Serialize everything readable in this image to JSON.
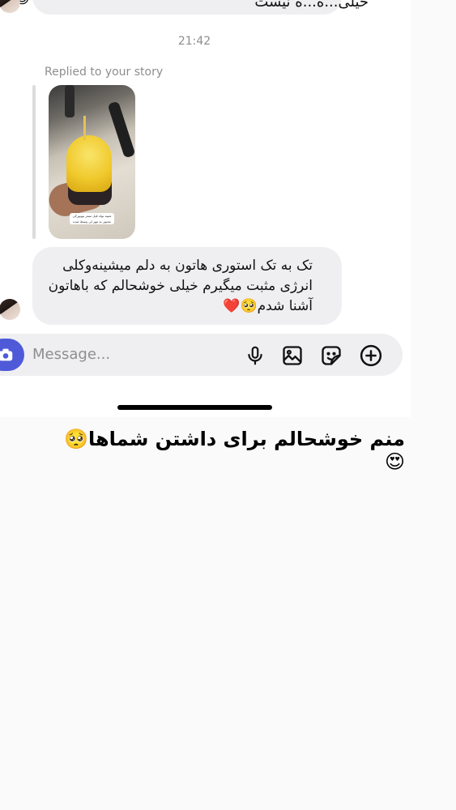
{
  "chat": {
    "previous_message_partial": "خیلی...ه...ه نیست",
    "previous_message_emoji": "😊",
    "timestamp": "21:42",
    "replied_label": "Replied to your story",
    "story": {
      "sticker_text": "شبیه تولد قبل سفر نیویورکی مجبور به مهر لی وسط شده"
    },
    "message_text": "تک به تک استوری هاتون به دلم میشینه‌وکلی انرژی مثبت میگیرم خیلی خوشحالم که باهاتون آشنا شدم🥺❤️"
  },
  "composer": {
    "placeholder": "Message...",
    "icons": [
      "camera-icon",
      "microphone-icon",
      "gallery-icon",
      "sticker-icon",
      "add-icon"
    ]
  },
  "caption": "منم خوشحالم برای داشتن شماها🥺😍",
  "colors": {
    "bubble_bg": "#efeff1",
    "camera_accent": "#4e5ad8",
    "meta_text": "#8e8e8e"
  }
}
